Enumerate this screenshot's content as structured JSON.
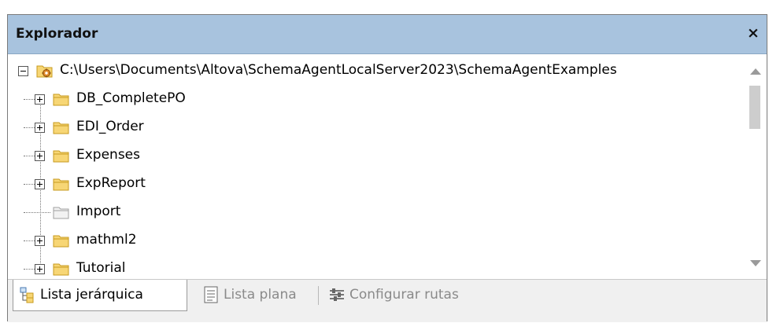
{
  "panel": {
    "title": "Explorador",
    "close_label": "×"
  },
  "tree": {
    "root": {
      "label": "C:\\Users\\Documents\\Altova\\SchemaAgentLocalServer2023\\SchemaAgentExamples",
      "expanded": true,
      "icon": "gear-folder-icon"
    },
    "children": [
      {
        "label": "DB_CompletePO",
        "expandable": true,
        "icon": "folder-icon"
      },
      {
        "label": "EDI_Order",
        "expandable": true,
        "icon": "folder-icon"
      },
      {
        "label": "Expenses",
        "expandable": true,
        "icon": "folder-icon"
      },
      {
        "label": "ExpReport",
        "expandable": true,
        "icon": "folder-icon"
      },
      {
        "label": "Import",
        "expandable": false,
        "icon": "folder-icon-empty"
      },
      {
        "label": "mathml2",
        "expandable": true,
        "icon": "folder-icon"
      },
      {
        "label": "Tutorial",
        "expandable": true,
        "icon": "folder-icon"
      }
    ]
  },
  "tabs": [
    {
      "label": "Lista jerárquica",
      "active": true,
      "icon": "hierarchy-icon"
    },
    {
      "label": "Lista plana",
      "active": false,
      "icon": "flat-list-icon"
    },
    {
      "label": "Configurar rutas",
      "active": false,
      "icon": "paths-config-icon"
    }
  ],
  "colors": {
    "titlebar": "#a8c3de",
    "folder_fill": "#f7d675",
    "folder_stroke": "#c79a1e",
    "inactive_text": "#8a8a8a"
  }
}
